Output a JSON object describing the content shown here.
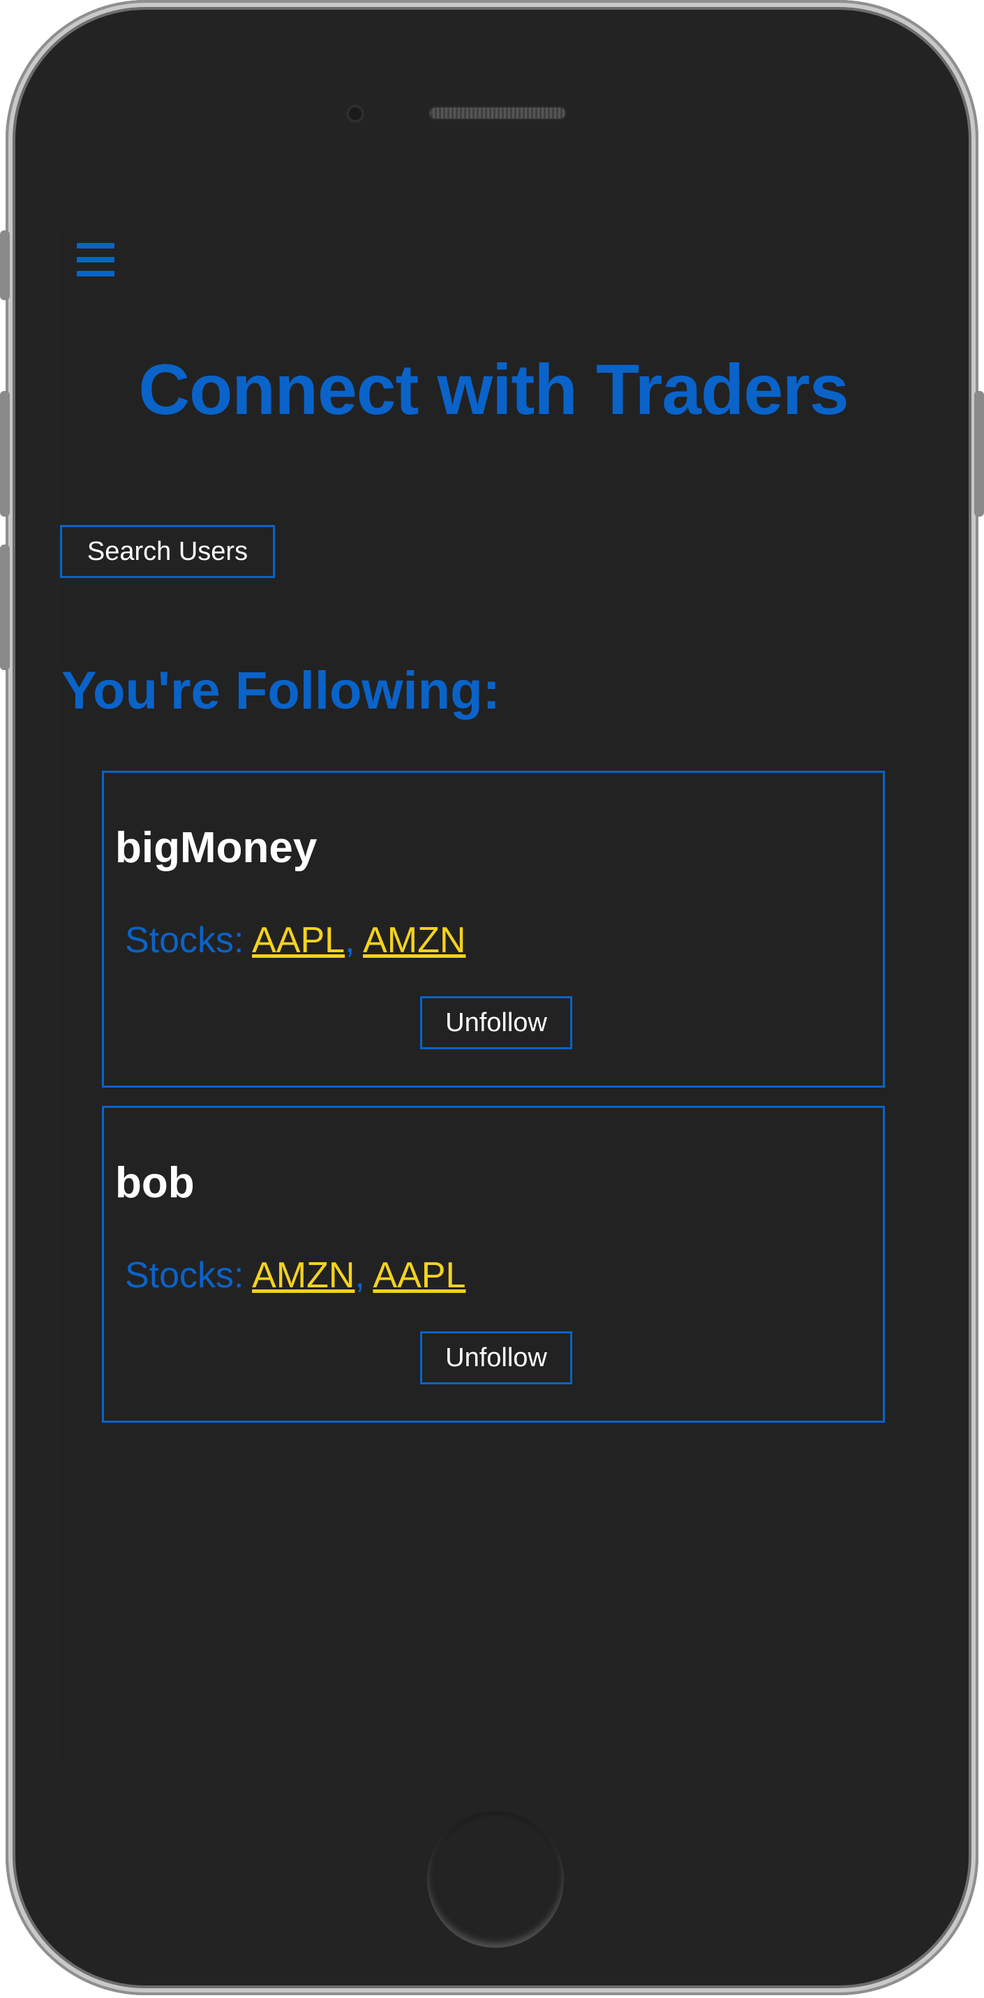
{
  "header": {
    "menu_icon": "hamburger-menu-icon",
    "title": "Connect with Traders"
  },
  "search": {
    "button_label": "Search Users"
  },
  "following": {
    "heading": "You're Following:",
    "stocks_label": "Stocks:",
    "separator": ",",
    "unfollow_label": "Unfollow",
    "users": [
      {
        "name": "bigMoney",
        "stocks": [
          "AAPL",
          "AMZN"
        ]
      },
      {
        "name": "bob",
        "stocks": [
          "AMZN",
          "AAPL"
        ]
      }
    ]
  },
  "colors": {
    "accent": "#0a63c9",
    "stock_link": "#f4d21f",
    "background": "#222222",
    "text": "#ffffff"
  }
}
